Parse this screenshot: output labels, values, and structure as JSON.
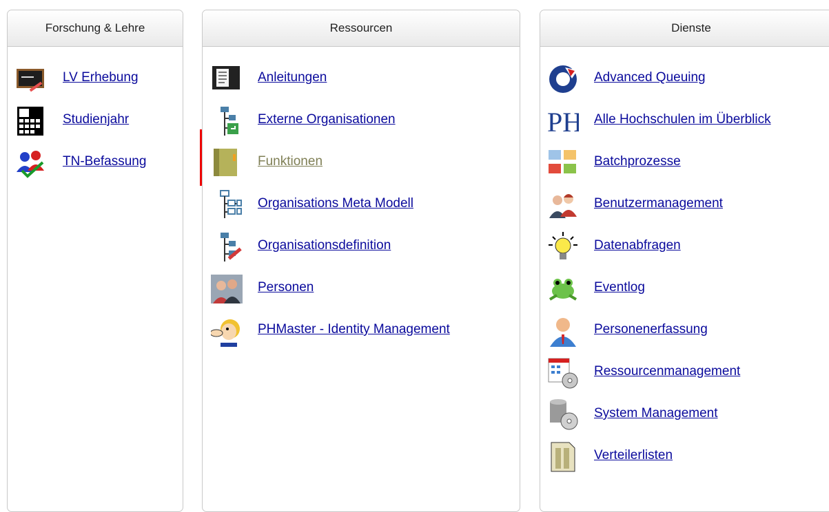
{
  "panels": [
    {
      "title": "Forschung & Lehre",
      "items": [
        {
          "label": "LV Erhebung",
          "icon": "chalkboard-icon"
        },
        {
          "label": "Studienjahr",
          "icon": "calendar-icon"
        },
        {
          "label": "TN-Befassung",
          "icon": "users-check-icon"
        }
      ]
    },
    {
      "title": "Ressourcen",
      "items": [
        {
          "label": "Anleitungen",
          "icon": "manual-icon"
        },
        {
          "label": "Externe Organisationen",
          "icon": "org-tree-external-icon"
        },
        {
          "label": "Funktionen",
          "icon": "folder-book-icon",
          "highlighted": true
        },
        {
          "label": "Organisations Meta Modell",
          "icon": "org-tree-icon"
        },
        {
          "label": "Organisationsdefinition",
          "icon": "org-tree-edit-icon"
        },
        {
          "label": "Personen",
          "icon": "persons-icon"
        },
        {
          "label": "PHMaster - Identity Management",
          "icon": "cartoon-face-icon"
        }
      ]
    },
    {
      "title": "Dienste",
      "items": [
        {
          "label": "Advanced Queuing",
          "icon": "refresh-arrow-icon"
        },
        {
          "label": "Alle Hochschulen im Überblick",
          "icon": "ph-logo-icon"
        },
        {
          "label": "Batchprozesse",
          "icon": "folders-icon"
        },
        {
          "label": "Benutzermanagement",
          "icon": "users-icon"
        },
        {
          "label": "Datenabfragen",
          "icon": "lightbulb-icon"
        },
        {
          "label": "Eventlog",
          "icon": "frog-icon"
        },
        {
          "label": "Personenerfassung",
          "icon": "user-avatar-icon"
        },
        {
          "label": "Ressourcenmanagement",
          "icon": "calendar-cd-icon"
        },
        {
          "label": "System Management",
          "icon": "database-cd-icon"
        },
        {
          "label": "Verteilerlisten",
          "icon": "document-list-icon"
        }
      ]
    }
  ]
}
